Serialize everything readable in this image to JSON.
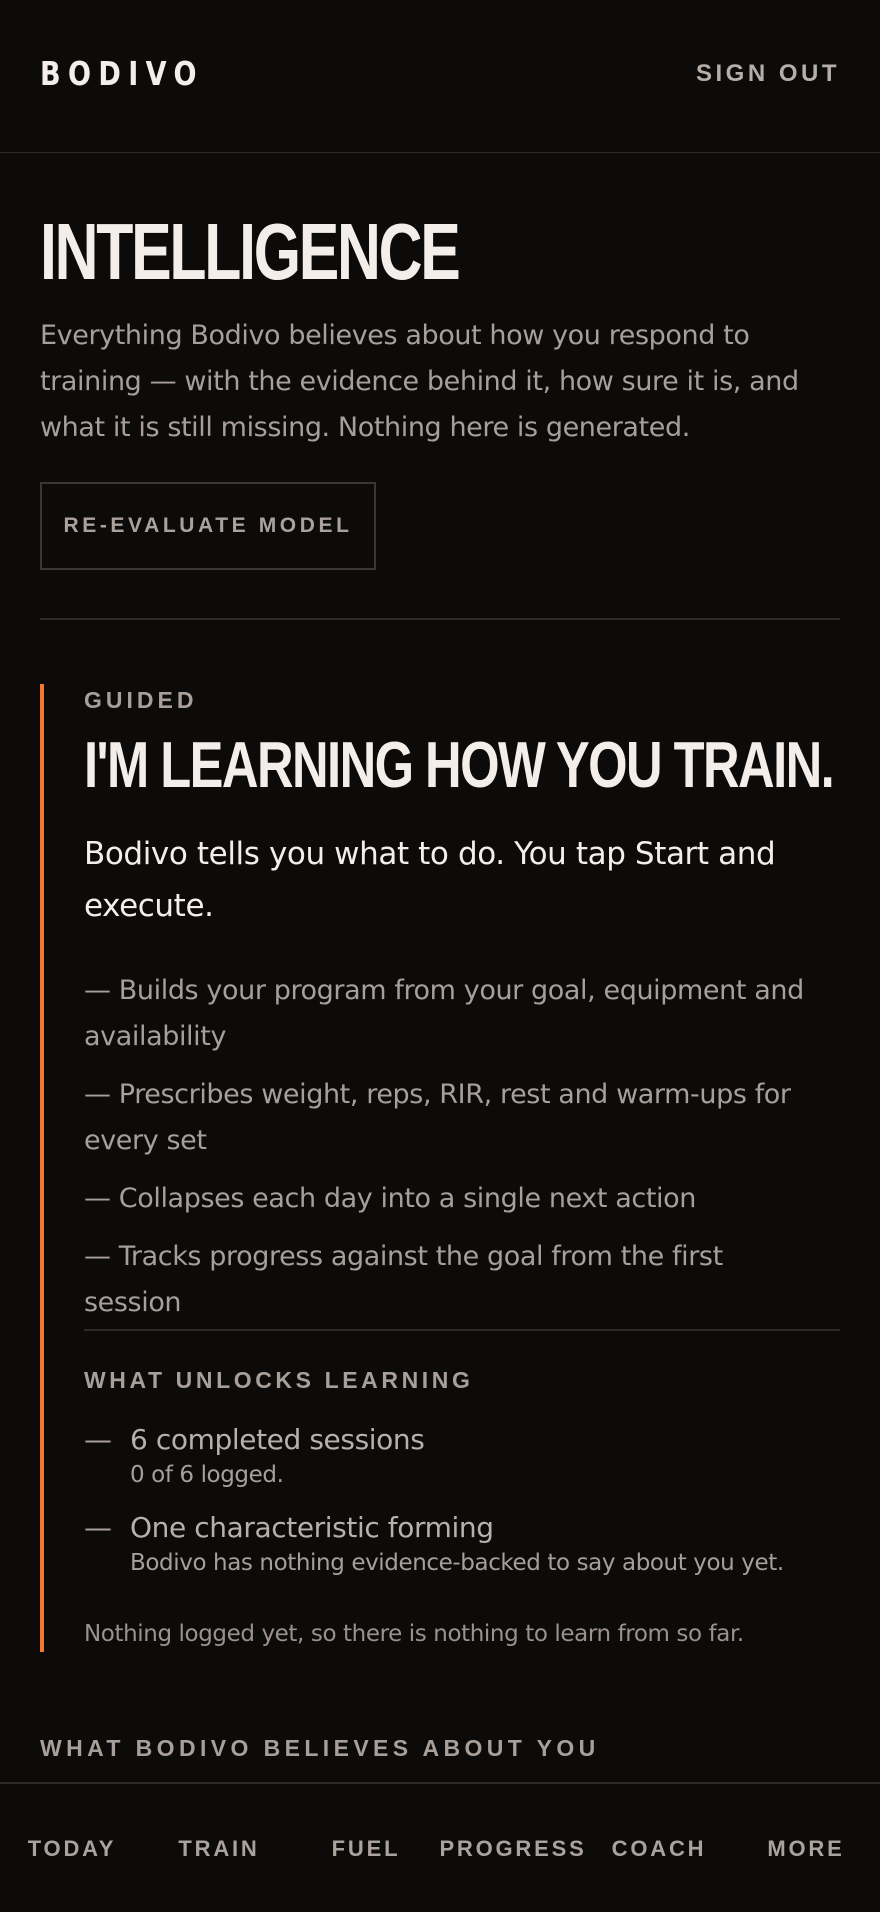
{
  "header": {
    "brand": "BODIVO",
    "sign_out": "SIGN OUT"
  },
  "intro": {
    "title": "INTELLIGENCE",
    "description": "Everything Bodivo believes about how you respond to training — with the evidence behind it, how sure it is, and what it is still missing. Nothing here is generated.",
    "reevaluate_label": "RE-EVALUATE MODEL"
  },
  "guided": {
    "kicker": "GUIDED",
    "title": "I'M LEARNING HOW YOU TRAIN.",
    "lead": "Bodivo tells you what to do. You tap Start and execute.",
    "features": [
      "— Builds your program from your goal, equipment and availability",
      "— Prescribes weight, reps, RIR, rest and warm-ups for every set",
      "— Collapses each day into a single next action",
      "— Tracks progress against the goal from the first session"
    ],
    "unlocks_heading": "WHAT UNLOCKS LEARNING",
    "unlocks": [
      {
        "dash": "—",
        "title": "6 completed sessions",
        "detail": "0 of 6 logged."
      },
      {
        "dash": "—",
        "title": "One characteristic forming",
        "detail": "Bodivo has nothing evidence-backed to say about you yet."
      }
    ],
    "note": "Nothing logged yet, so there is nothing to learn from so far."
  },
  "beliefs": {
    "heading": "WHAT BODIVO BELIEVES ABOUT YOU"
  },
  "nav": {
    "items": [
      {
        "label": "TODAY"
      },
      {
        "label": "TRAIN"
      },
      {
        "label": "FUEL"
      },
      {
        "label": "PROGRESS"
      },
      {
        "label": "COACH"
      },
      {
        "label": "MORE"
      }
    ]
  },
  "colors": {
    "background": "#0d0a0a",
    "accent": "#f07830",
    "text_primary": "#f3eee9",
    "text_muted": "#a79f99",
    "divider": "#2f2a28"
  }
}
